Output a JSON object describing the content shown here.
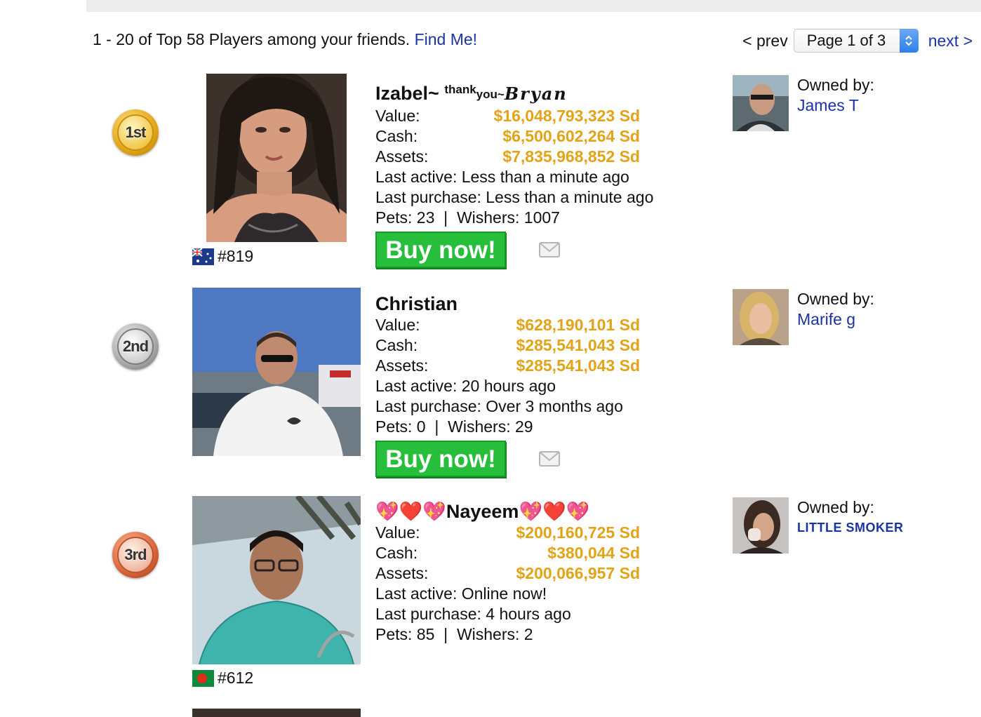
{
  "summary": {
    "text": "1 - 20 of Top 58 Players among your friends.",
    "find_me": "Find Me!"
  },
  "pager": {
    "prev": "< prev",
    "page_select": "Page 1 of 3",
    "next": "next >"
  },
  "players": [
    {
      "medal": "1st",
      "name_main": "Izabel~",
      "name_thank": "thank",
      "name_you": "you~",
      "name_script": "Bryan",
      "rank": "#819",
      "flag": "australia-flag-icon",
      "value_label": "Value:",
      "value": "$16,048,793,323 Sd",
      "cash_label": "Cash:",
      "cash": "$6,500,602,264 Sd",
      "assets_label": "Assets:",
      "assets": "$7,835,968,852 Sd",
      "last_active": "Last active: Less than a minute ago",
      "last_purchase": "Last purchase: Less than a minute ago",
      "pets": "Pets: 23",
      "wishers": "Wishers: 1007",
      "buy_label": "Buy now!",
      "owner_label": "Owned by:",
      "owner_name": "James T"
    },
    {
      "medal": "2nd",
      "name": "Christian",
      "value_label": "Value:",
      "value": "$628,190,101 Sd",
      "cash_label": "Cash:",
      "cash": "$285,541,043 Sd",
      "assets_label": "Assets:",
      "assets": "$285,541,043 Sd",
      "last_active": "Last active: 20 hours ago",
      "last_purchase": "Last purchase: Over 3 months ago",
      "pets": "Pets: 0",
      "wishers": "Wishers: 29",
      "buy_label": "Buy now!",
      "owner_label": "Owned by:",
      "owner_name": "Marife g"
    },
    {
      "medal": "3rd",
      "name_prefix": "💖❤️💖",
      "name": "Nayeem",
      "name_suffix": "💖❤️💖",
      "rank": "#612",
      "flag": "bangladesh-flag-icon",
      "value_label": "Value:",
      "value": "$200,160,725 Sd",
      "cash_label": "Cash:",
      "cash": "$380,044 Sd",
      "assets_label": "Assets:",
      "assets": "$200,066,957 Sd",
      "last_active": "Last active: Online now!",
      "last_purchase": "Last purchase: 4 hours ago",
      "pets": "Pets: 85",
      "wishers": "Wishers: 2",
      "owner_label": "Owned by:",
      "owner_name": "LITTLE SMOKER"
    }
  ],
  "colors": {
    "money": "#e3a317",
    "link": "#1a33a6",
    "buy_button": "#26be3a"
  }
}
